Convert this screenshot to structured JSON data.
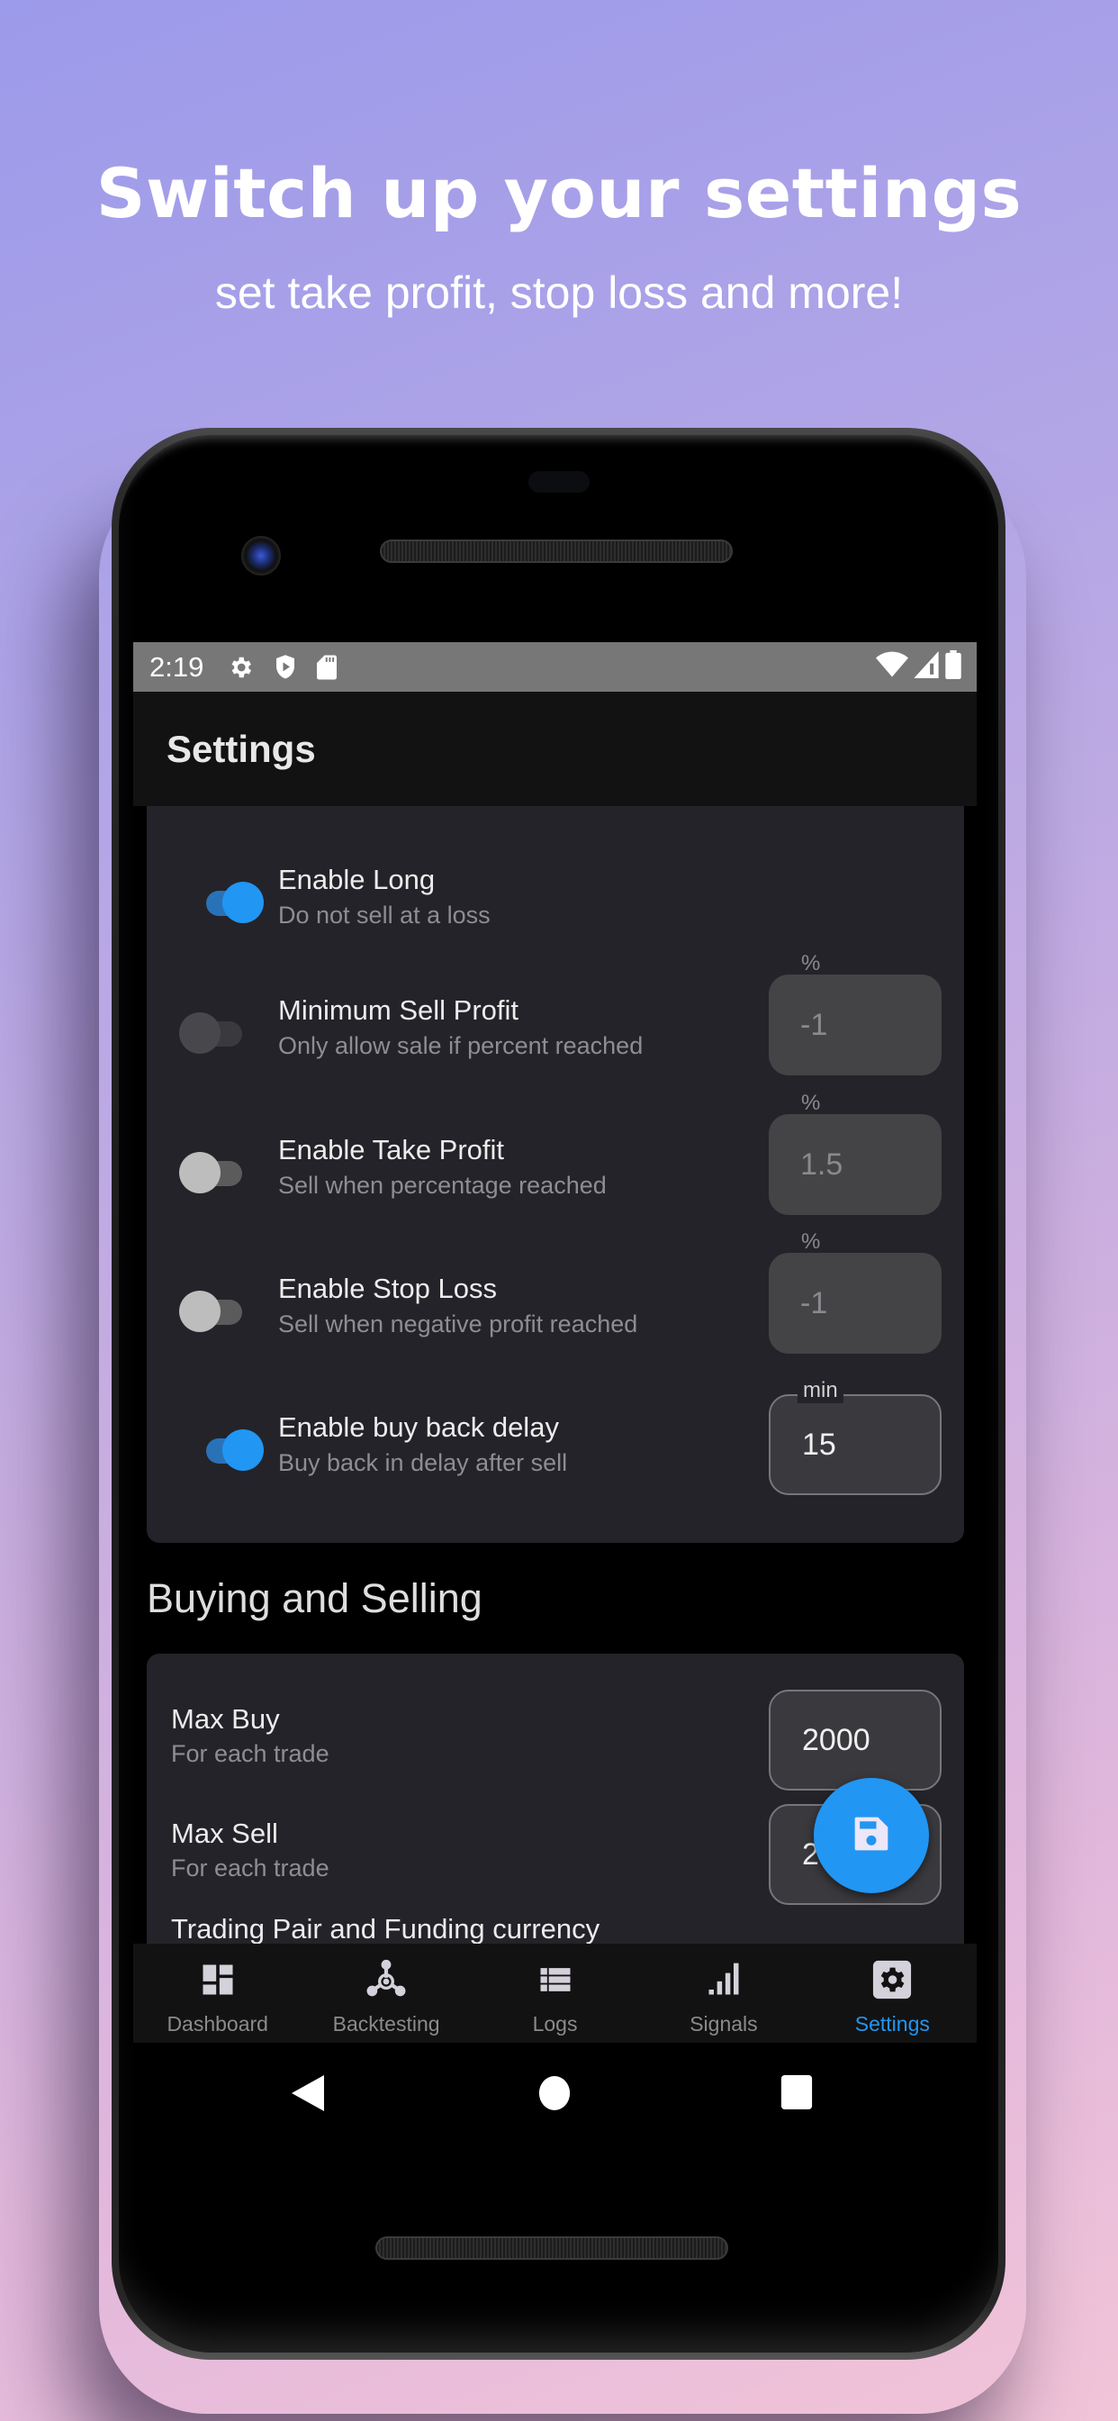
{
  "promo": {
    "headline": "Switch up your settings",
    "subheadline": "set take profit, stop loss and more!"
  },
  "status_bar": {
    "time": "2:19",
    "left_icons": [
      "settings-icon",
      "shield-play-icon",
      "sd-card-icon"
    ],
    "right_icons": [
      "wifi-icon",
      "cell-signal-icon",
      "battery-icon"
    ]
  },
  "app_bar": {
    "title": "Settings"
  },
  "trade_settings": {
    "rows": [
      {
        "title": "Enable Long",
        "subtitle": "Do not sell at a loss",
        "enabled": true,
        "toggle_state": "on"
      },
      {
        "title": "Minimum Sell Profit",
        "subtitle": "Only allow sale if percent reached",
        "enabled": false,
        "toggle_state": "disabled",
        "field_label": "%",
        "field_value": "-1"
      },
      {
        "title": "Enable Take Profit",
        "subtitle": "Sell when percentage reached",
        "enabled": false,
        "toggle_state": "off",
        "field_label": "%",
        "field_value": "1.5"
      },
      {
        "title": "Enable Stop Loss",
        "subtitle": "Sell when negative profit reached",
        "enabled": false,
        "toggle_state": "off",
        "field_label": "%",
        "field_value": "-1"
      },
      {
        "title": "Enable buy back delay",
        "subtitle": "Buy back in delay after sell",
        "enabled": true,
        "toggle_state": "on",
        "field_label": "min",
        "field_value": "15"
      }
    ]
  },
  "buying_selling": {
    "section_title": "Buying and Selling",
    "rows": [
      {
        "title": "Max Buy",
        "subtitle": "For each trade",
        "field_value": "2000"
      },
      {
        "title": "Max Sell",
        "subtitle": "For each trade",
        "field_value": "2000"
      }
    ],
    "trailing_label": "Trading Pair and Funding currency"
  },
  "fab": {
    "icon": "save-icon",
    "label": "Save"
  },
  "bottom_nav": {
    "items": [
      {
        "label": "Dashboard",
        "icon": "dashboard-icon",
        "active": false
      },
      {
        "label": "Backtesting",
        "icon": "backtesting-icon",
        "active": false
      },
      {
        "label": "Logs",
        "icon": "list-icon",
        "active": false
      },
      {
        "label": "Signals",
        "icon": "signal-bars-icon",
        "active": false
      },
      {
        "label": "Settings",
        "icon": "settings-icon",
        "active": true
      }
    ]
  },
  "colors": {
    "accent": "#2196f3",
    "card": "#242329",
    "app_bar": "#121212",
    "status_bar": "#777777",
    "inactive_nav": "#8b8b8b"
  }
}
